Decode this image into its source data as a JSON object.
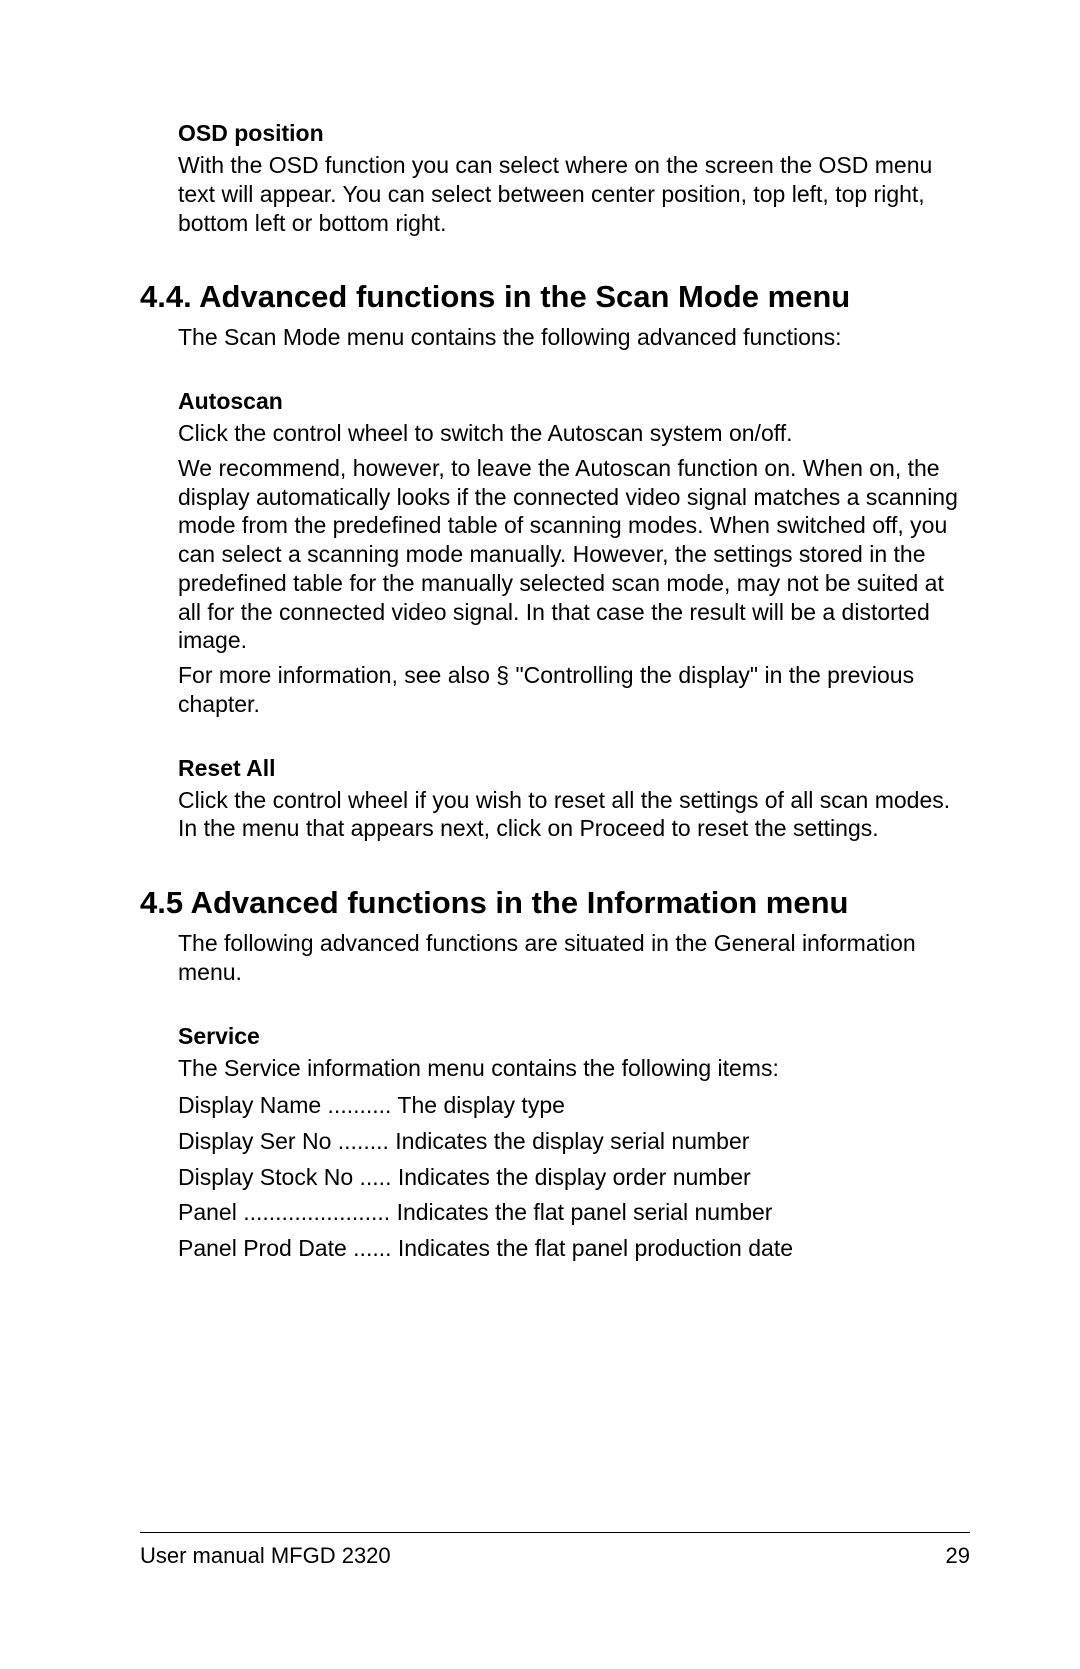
{
  "osd": {
    "title": "OSD position",
    "body": "With the OSD function you can select where on the screen the OSD menu text will appear. You can select between center position, top left, top right, bottom left or bottom right."
  },
  "section44": {
    "heading": "4.4. Advanced functions in the Scan Mode menu",
    "intro": "The Scan Mode menu contains the following advanced functions:"
  },
  "autoscan": {
    "title": "Autoscan",
    "p1": "Click the control wheel to switch the Autoscan system on/off.",
    "p2": "We recommend, however, to leave the Autoscan function on. When on, the display automatically looks if the connected video signal matches a scanning mode from the predefined table of scanning modes. When switched off, you can select a scanning mode manually. However, the settings stored in the predefined table for the manually selected scan mode, may not be suited at all for the connected video signal. In that case the result will be a distorted image.",
    "p3": "For more information, see also § \"Controlling the display\" in the previous chapter."
  },
  "resetAll": {
    "title": "Reset All",
    "body": "Click the control wheel if you wish to reset all the settings of all scan modes. In the menu that appears next, click on Proceed to reset the settings."
  },
  "section45": {
    "heading": "4.5 Advanced functions in the Information menu",
    "intro": "The following advanced functions are situated in the General information menu."
  },
  "service": {
    "title": "Service",
    "intro": "The Service information menu contains the following items:",
    "rows": {
      "r1": "Display Name .......... The display type",
      "r2": "Display Ser No ........ Indicates the display serial number",
      "r3": "Display Stock No ..... Indicates the display order number",
      "r4": "Panel ....................... Indicates the flat panel serial number",
      "r5": "Panel Prod Date ...... Indicates the flat panel production date"
    }
  },
  "footer": {
    "left": "User manual MFGD 2320",
    "right": "29"
  }
}
